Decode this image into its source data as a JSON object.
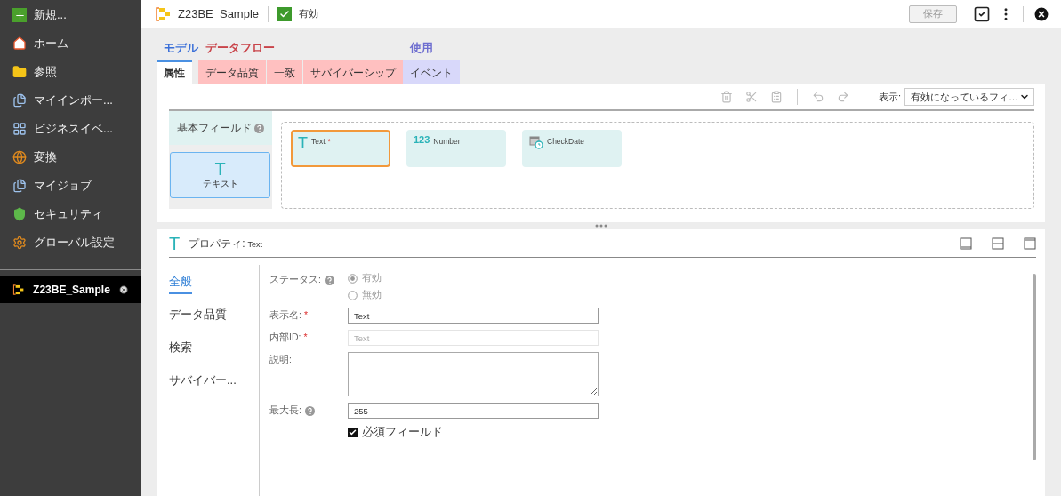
{
  "sidebar": {
    "items": [
      {
        "label": "新規..."
      },
      {
        "label": "ホーム"
      },
      {
        "label": "参照"
      },
      {
        "label": "マイインポー..."
      },
      {
        "label": "ビジネスイベ..."
      },
      {
        "label": "変換"
      },
      {
        "label": "マイジョブ"
      },
      {
        "label": "セキュリティ"
      },
      {
        "label": "グローバル設定"
      }
    ],
    "open_tabs": [
      {
        "label": "Z23BE_Sample",
        "selected": true
      }
    ]
  },
  "header": {
    "title": "Z23BE_Sample",
    "valid": true,
    "status": "有効",
    "save": {
      "label": "保存",
      "disabled": true
    }
  },
  "tab_groups": [
    {
      "label": "モデル",
      "color": "#3a6fd8",
      "tabs": [
        {
          "label": "属性",
          "selected": true
        }
      ]
    },
    {
      "label": "データフロー",
      "color": "#c9444a",
      "tabs": [
        {
          "label": "データ品質",
          "selected": false
        },
        {
          "label": "一致",
          "selected": false
        },
        {
          "label": "サバイバーシップ",
          "selected": false
        }
      ]
    },
    {
      "label": "使用",
      "color": "#6f6fd0",
      "tabs": [
        {
          "label": "イベント",
          "selected": false
        }
      ]
    }
  ],
  "toolbar": {
    "display_label": "表示:",
    "display_value": "有効になっているフィ…"
  },
  "palette": {
    "title": "基本フィールド",
    "items": [
      {
        "glyph": "T",
        "label": "テキスト",
        "selected": true
      }
    ]
  },
  "canvas": {
    "fields": [
      {
        "kind": "text",
        "glyph": "T",
        "label": "Text",
        "mark": "*",
        "selected": true
      },
      {
        "kind": "number",
        "glyph": "123",
        "label": "Number",
        "selected": false
      },
      {
        "kind": "date",
        "label": "CheckDate",
        "selected": false
      }
    ]
  },
  "properties": {
    "glyph": "T",
    "title": "プロパティ:",
    "subject": "Text",
    "nav": [
      {
        "label": "全般",
        "selected": true
      },
      {
        "label": "データ品質",
        "selected": false
      },
      {
        "label": "検索",
        "selected": false
      },
      {
        "label": "サバイバー...",
        "selected": false
      }
    ],
    "fields": [
      {
        "kind": "radio",
        "label": "ステータス:",
        "help": true,
        "disabled": true,
        "options": [
          {
            "label": "有効",
            "selected": true
          },
          {
            "label": "無効",
            "selected": false
          }
        ]
      },
      {
        "kind": "text",
        "label": "表示名:",
        "mark": "*",
        "value": "Text",
        "disabled": false
      },
      {
        "kind": "text",
        "label": "内部ID:",
        "mark": "*",
        "value": "Text",
        "disabled": true
      },
      {
        "kind": "textarea",
        "label": "説明:"
      },
      {
        "kind": "text",
        "label": "最大長:",
        "help": true,
        "value": "255",
        "disabled": false
      },
      {
        "kind": "checkbox",
        "label": "必須フィールド",
        "checked": true
      }
    ]
  }
}
